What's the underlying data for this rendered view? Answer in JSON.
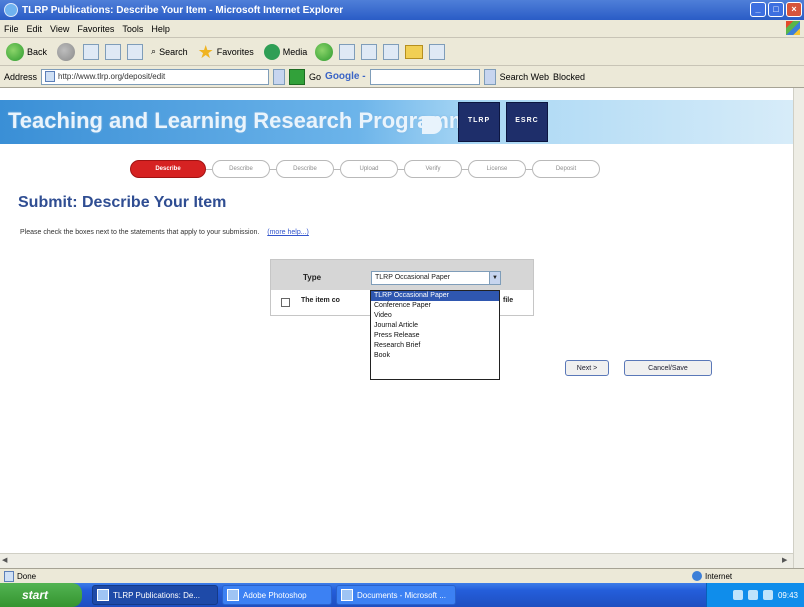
{
  "window": {
    "title": "TLRP Publications: Describe Your Item - Microsoft Internet Explorer",
    "buttons": [
      "_",
      "□",
      "×"
    ]
  },
  "menu": [
    "File",
    "Edit",
    "View",
    "Favorites",
    "Tools",
    "Help"
  ],
  "toolbar": {
    "back": "Back",
    "search": "Search",
    "favorites": "Favorites",
    "media": "Media"
  },
  "address": {
    "label": "Address",
    "url": "http://www.tlrp.org/deposit/edit",
    "go": "Go",
    "google_label": "Google -",
    "search_web": "Search Web",
    "blocked": "Blocked"
  },
  "page": {
    "banner_title": "Teaching and Learning Research Programme",
    "logo1": "TLRP",
    "logo2": "ESRC",
    "steps": [
      "Describe",
      "Describe",
      "Describe",
      "Upload",
      "Verify",
      "License",
      "Deposit"
    ],
    "heading": "Submit: Describe Your Item",
    "instructions": "Please check the boxes next to the statements that apply to your submission.",
    "help_link": "(more help...)",
    "form": {
      "type_label": "Type",
      "type_value": "TLRP Occasional Paper",
      "checkbox_label": "The item co",
      "checkbox_label_end": "file"
    },
    "dropdown_options": [
      "TLRP Occasional Paper",
      "Conference Paper",
      "Video",
      "Journal Article",
      "Press Release",
      "Research Brief",
      "Book"
    ],
    "next_button": "Next >",
    "cancel_button": "Cancel/Save"
  },
  "status": {
    "left": "Done",
    "zone": "Internet"
  },
  "taskbar": {
    "start": "start",
    "tasks": [
      "TLRP Publications: De...",
      "Adobe Photoshop",
      "Documents - Microsoft ..."
    ],
    "time": "09:43"
  }
}
